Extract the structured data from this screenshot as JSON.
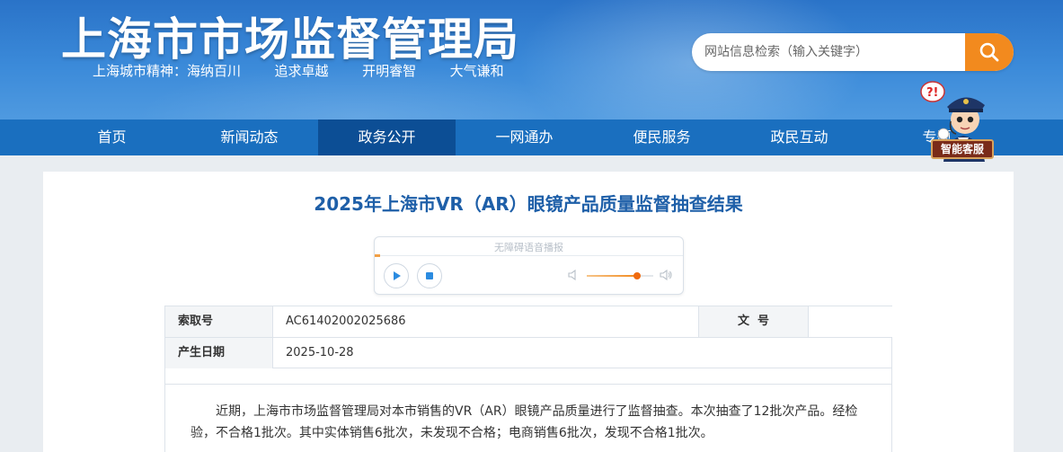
{
  "header": {
    "site_title": "上海市市场监督管理局",
    "slogan": "上海城市精神：海纳百川  追求卓越  开明睿智  大气谦和"
  },
  "search": {
    "placeholder": "网站信息检索（输入关键字）"
  },
  "nav": {
    "items": [
      "首页",
      "新闻动态",
      "政务公开",
      "一网通办",
      "便民服务",
      "政民互动",
      "专题"
    ],
    "active_index": 2
  },
  "assistant": {
    "label": "智能客服"
  },
  "article": {
    "title": "2025年上海市VR（AR）眼镜产品质量监督抽查结果",
    "player_title": "无障碍语音播报",
    "volume_level": 0.75,
    "meta": {
      "index_label": "索取号",
      "index_value": "AC61402002025686",
      "doc_label": "文  号",
      "doc_value": "",
      "date_label": "产生日期",
      "date_value": "2025-10-28"
    },
    "body": "近期，上海市市场监督管理局对本市销售的VR（AR）眼镜产品质量进行了监督抽查。本次抽查了12批次产品。经检验，不合格1批次。其中实体销售6批次，未发现不合格；电商销售6批次，发现不合格1批次。"
  },
  "colors": {
    "header_blue": "#2a73c8",
    "nav_blue": "#1a6fbf",
    "nav_active": "#0c4e95",
    "search_orange": "#f28a1e",
    "title_blue": "#1e5fa8"
  }
}
